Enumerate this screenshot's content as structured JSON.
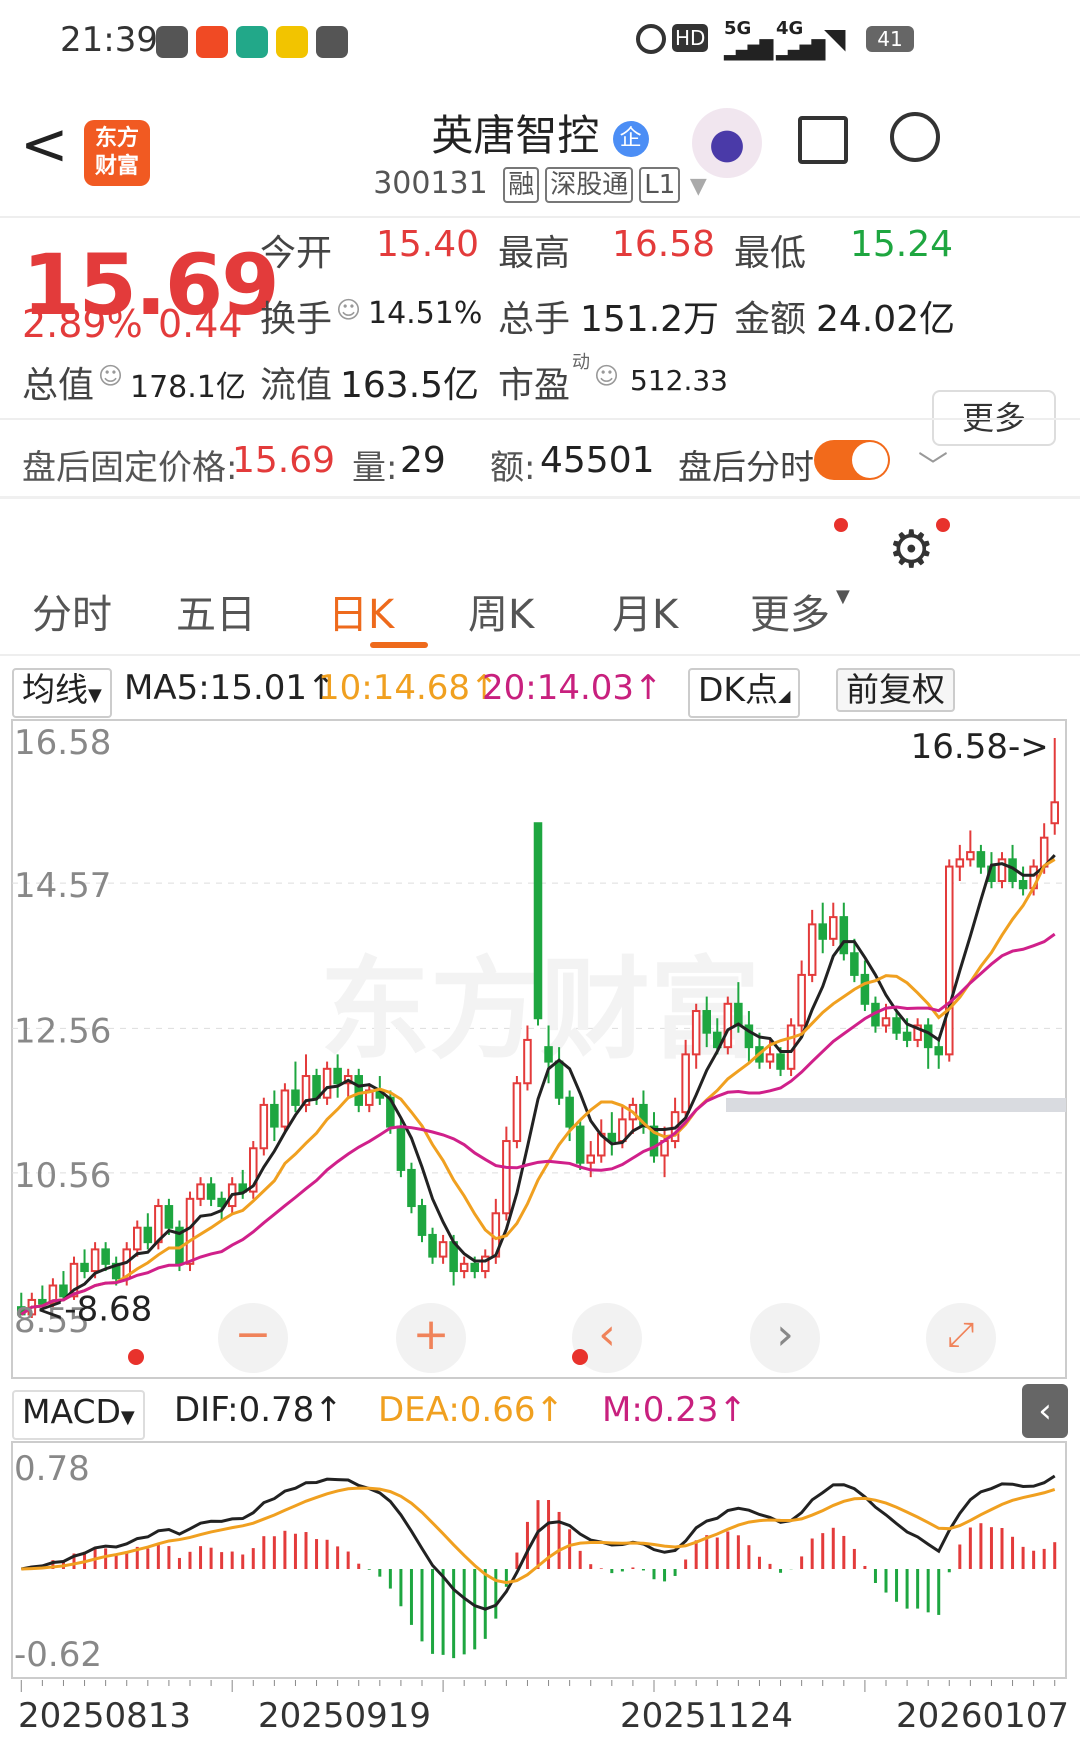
{
  "status_bar": {
    "time": "21:39",
    "battery": "41",
    "net1": "5G",
    "net2": "4G"
  },
  "header": {
    "logo_line1": "东方",
    "logo_line2": "财富",
    "stock_name": "英唐智控",
    "name_badge": "企",
    "stock_code": "300131",
    "tags": [
      "融",
      "深股通",
      "L1"
    ]
  },
  "quote": {
    "price": "15.69",
    "change_pct": "2.89%",
    "change_amt": "0.44",
    "open_label": "今开",
    "open": "15.40",
    "high_label": "最高",
    "high": "16.58",
    "low_label": "最低",
    "low": "15.24",
    "turnover_label": "换手",
    "turnover": "14.51%",
    "volume_label": "总手",
    "volume": "151.2万",
    "amount_label": "金额",
    "amount": "24.02亿",
    "mktcap_label": "总值",
    "mktcap": "178.1亿",
    "float_label": "流值",
    "float": "163.5亿",
    "pe_label": "市盈",
    "pe_sup": "动",
    "pe": "512.33",
    "more_label": "更多"
  },
  "after_hours": {
    "price_label": "盘后固定价格:",
    "price": "15.69",
    "vol_label": "量:",
    "vol": "29",
    "amt_label": "额:",
    "amt": "45501",
    "toggle_label": "盘后分时"
  },
  "tabs": [
    "分时",
    "五日",
    "日K",
    "周K",
    "月K",
    "更多"
  ],
  "active_tab": "日K",
  "indicator_bar": {
    "ma_select": "均线",
    "ma5": "MA5:15.01↑",
    "ma10": "10:14.68↑",
    "ma20": "20:14.03↑",
    "dk": "DK点",
    "adjust": "前复权"
  },
  "macd_bar": {
    "select": "MACD",
    "dif": "DIF:0.78↑",
    "dea": "DEA:0.66↑",
    "m": "M:0.23↑"
  },
  "chart_data": [
    {
      "type": "candlestick",
      "y_ticks": [
        "16.58",
        "14.57",
        "12.56",
        "10.56",
        "8.55"
      ],
      "ylim": [
        8.55,
        16.58
      ],
      "high_marker": "16.58->",
      "low_marker": "8.68",
      "watermark": "东方财富",
      "series": [
        {
          "name": "MA5",
          "color": "#222222"
        },
        {
          "name": "MA10",
          "color": "#f0a020"
        },
        {
          "name": "MA20",
          "color": "#d0208a"
        }
      ],
      "candles": [
        [
          8.7,
          8.6,
          8.9,
          8.6
        ],
        [
          8.6,
          8.8,
          8.9,
          8.55
        ],
        [
          8.8,
          8.75,
          9.0,
          8.7
        ],
        [
          8.75,
          9.0,
          9.1,
          8.7
        ],
        [
          9.0,
          8.85,
          9.2,
          8.8
        ],
        [
          8.85,
          9.3,
          9.4,
          8.8
        ],
        [
          9.3,
          9.2,
          9.5,
          9.1
        ],
        [
          9.2,
          9.5,
          9.6,
          9.1
        ],
        [
          9.5,
          9.3,
          9.6,
          9.2
        ],
        [
          9.3,
          9.1,
          9.4,
          9.0
        ],
        [
          9.1,
          9.5,
          9.6,
          9.0
        ],
        [
          9.5,
          9.8,
          9.9,
          9.4
        ],
        [
          9.8,
          9.6,
          10.0,
          9.5
        ],
        [
          9.6,
          10.1,
          10.2,
          9.5
        ],
        [
          10.1,
          9.8,
          10.2,
          9.7
        ],
        [
          9.8,
          9.3,
          9.9,
          9.2
        ],
        [
          9.3,
          10.2,
          10.3,
          9.2
        ],
        [
          10.2,
          10.4,
          10.5,
          10.1
        ],
        [
          10.4,
          10.2,
          10.5,
          10.1
        ],
        [
          10.2,
          10.1,
          10.3,
          9.9
        ],
        [
          10.1,
          10.4,
          10.5,
          10.0
        ],
        [
          10.4,
          10.3,
          10.6,
          10.2
        ],
        [
          10.3,
          10.9,
          11.0,
          10.2
        ],
        [
          10.9,
          11.5,
          11.6,
          10.8
        ],
        [
          11.5,
          11.2,
          11.7,
          11.0
        ],
        [
          11.2,
          11.7,
          11.8,
          11.1
        ],
        [
          11.7,
          11.5,
          12.1,
          11.4
        ],
        [
          11.5,
          11.9,
          12.2,
          11.4
        ],
        [
          11.9,
          11.6,
          12.0,
          11.5
        ],
        [
          11.6,
          12.0,
          12.1,
          11.5
        ],
        [
          12.0,
          11.8,
          12.2,
          11.6
        ],
        [
          11.8,
          11.9,
          12.0,
          11.6
        ],
        [
          11.9,
          11.5,
          12.0,
          11.4
        ],
        [
          11.5,
          11.7,
          11.8,
          11.4
        ],
        [
          11.7,
          11.6,
          11.9,
          11.5
        ],
        [
          11.6,
          11.2,
          11.7,
          11.1
        ],
        [
          11.2,
          10.6,
          11.3,
          10.5
        ],
        [
          10.6,
          10.1,
          10.7,
          10.0
        ],
        [
          10.1,
          9.7,
          10.2,
          9.6
        ],
        [
          9.7,
          9.4,
          9.8,
          9.3
        ],
        [
          9.4,
          9.6,
          9.7,
          9.3
        ],
        [
          9.6,
          9.2,
          9.7,
          9.0
        ],
        [
          9.2,
          9.3,
          9.4,
          9.1
        ],
        [
          9.3,
          9.2,
          9.4,
          9.1
        ],
        [
          9.2,
          9.4,
          9.5,
          9.1
        ],
        [
          9.4,
          10.0,
          10.2,
          9.3
        ],
        [
          10.0,
          11.0,
          11.2,
          9.9
        ],
        [
          11.0,
          11.8,
          11.9,
          10.9
        ],
        [
          11.8,
          12.4,
          12.6,
          11.7
        ],
        [
          15.4,
          12.7,
          15.4,
          12.6
        ],
        [
          12.3,
          12.1,
          12.6,
          11.8
        ],
        [
          12.1,
          11.6,
          12.3,
          11.5
        ],
        [
          11.6,
          11.2,
          11.7,
          11.0
        ],
        [
          11.2,
          10.7,
          11.3,
          10.6
        ],
        [
          10.7,
          10.8,
          11.0,
          10.5
        ],
        [
          10.8,
          11.1,
          11.3,
          10.7
        ],
        [
          11.1,
          11.0,
          11.4,
          10.8
        ],
        [
          11.0,
          11.3,
          11.5,
          10.9
        ],
        [
          11.3,
          11.5,
          11.6,
          11.1
        ],
        [
          11.5,
          11.2,
          11.7,
          11.1
        ],
        [
          11.2,
          10.8,
          11.4,
          10.7
        ],
        [
          10.8,
          11.0,
          11.2,
          10.5
        ],
        [
          11.0,
          11.4,
          11.6,
          10.9
        ],
        [
          11.4,
          12.2,
          12.4,
          11.3
        ],
        [
          12.2,
          12.8,
          12.9,
          12.0
        ],
        [
          12.8,
          12.5,
          13.0,
          12.3
        ],
        [
          12.5,
          12.3,
          12.7,
          12.2
        ],
        [
          12.3,
          12.9,
          13.0,
          12.2
        ],
        [
          12.9,
          12.6,
          13.2,
          12.5
        ],
        [
          12.6,
          12.3,
          12.8,
          12.1
        ],
        [
          12.3,
          12.1,
          12.5,
          12.0
        ],
        [
          12.1,
          12.2,
          12.4,
          12.0
        ],
        [
          12.2,
          12.0,
          12.3,
          11.9
        ],
        [
          12.0,
          12.6,
          12.7,
          11.9
        ],
        [
          12.6,
          13.3,
          13.5,
          12.5
        ],
        [
          13.3,
          14.0,
          14.2,
          13.2
        ],
        [
          14.0,
          13.8,
          14.3,
          13.6
        ],
        [
          13.8,
          14.1,
          14.3,
          13.7
        ],
        [
          14.1,
          13.6,
          14.3,
          13.5
        ],
        [
          13.6,
          13.3,
          13.8,
          13.2
        ],
        [
          13.3,
          12.9,
          13.5,
          12.8
        ],
        [
          12.9,
          12.6,
          13.0,
          12.5
        ],
        [
          12.6,
          12.7,
          12.9,
          12.5
        ],
        [
          12.7,
          12.5,
          12.8,
          12.4
        ],
        [
          12.5,
          12.4,
          12.7,
          12.3
        ],
        [
          12.4,
          12.6,
          12.7,
          12.3
        ],
        [
          12.6,
          12.3,
          12.7,
          12.0
        ],
        [
          12.3,
          12.2,
          12.4,
          12.0
        ],
        [
          12.2,
          14.8,
          14.9,
          12.1
        ],
        [
          14.8,
          14.9,
          15.1,
          14.6
        ],
        [
          14.9,
          15.0,
          15.3,
          14.8
        ],
        [
          15.0,
          14.8,
          15.1,
          14.7
        ],
        [
          14.8,
          14.6,
          15.0,
          14.5
        ],
        [
          14.6,
          14.9,
          15.0,
          14.5
        ],
        [
          14.9,
          14.6,
          15.1,
          14.5
        ],
        [
          14.6,
          14.5,
          14.8,
          14.4
        ],
        [
          14.5,
          14.8,
          14.9,
          14.4
        ],
        [
          14.8,
          15.2,
          15.4,
          14.7
        ],
        [
          15.4,
          15.69,
          16.58,
          15.24
        ]
      ]
    },
    {
      "type": "bar+line",
      "name": "MACD",
      "y_ticks": [
        "0.78",
        "-0.62"
      ],
      "ylim": [
        -0.62,
        0.78
      ]
    }
  ],
  "x_ticks": [
    "20250813",
    "20250919",
    "20251124",
    "20260107"
  ]
}
